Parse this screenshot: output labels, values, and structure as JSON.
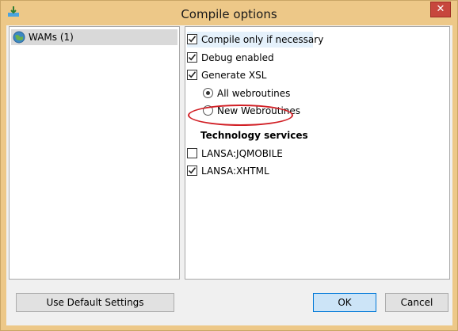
{
  "window": {
    "title": "Compile options",
    "close_label": "✕"
  },
  "tree": {
    "items": [
      {
        "label": "WAMs (1)"
      }
    ]
  },
  "options": {
    "compile_only": {
      "label": "Compile only if necessary",
      "checked": true
    },
    "debug_enabled": {
      "label": "Debug enabled",
      "checked": true
    },
    "generate_xsl": {
      "label": "Generate XSL",
      "checked": true
    },
    "radio_all": {
      "label": "All webroutines",
      "selected": true
    },
    "radio_new": {
      "label": "New Webroutines",
      "selected": false
    }
  },
  "technology": {
    "title": "Technology services",
    "items": [
      {
        "label": "LANSA:JQMOBILE",
        "checked": false
      },
      {
        "label": "LANSA:XHTML",
        "checked": true
      }
    ]
  },
  "buttons": {
    "default_settings": "Use Default Settings",
    "ok": "OK",
    "cancel": "Cancel"
  },
  "colors": {
    "titlebar": "#edc888",
    "close": "#c7473d",
    "annotation": "#d11f25",
    "ok_focus": "#0078d7"
  }
}
